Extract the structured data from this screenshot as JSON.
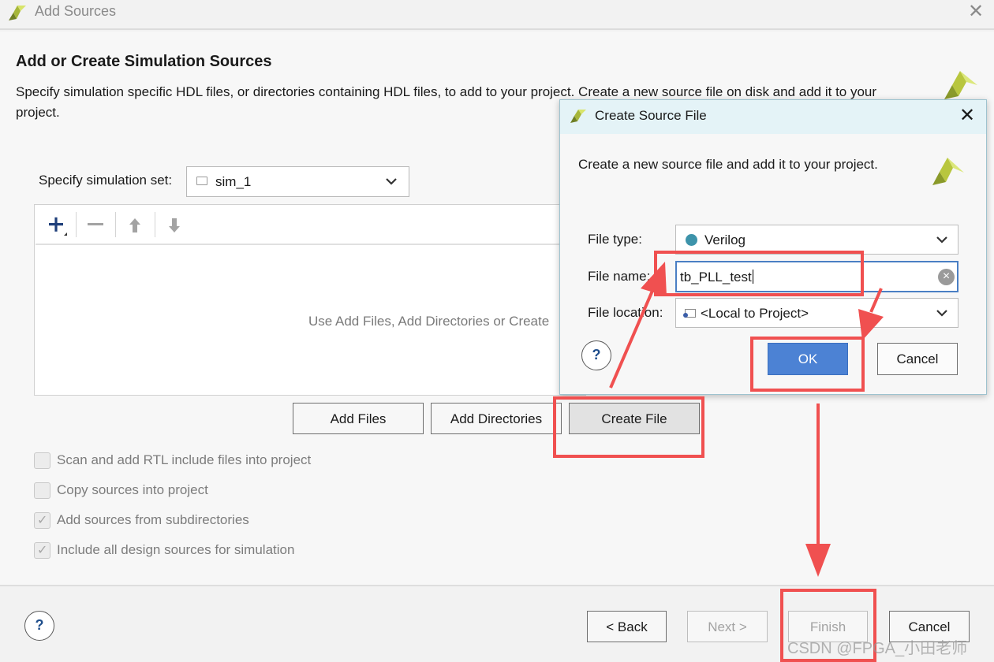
{
  "window": {
    "title": "Add Sources",
    "heading": "Add or Create Simulation Sources",
    "description": "Specify simulation specific HDL files, or directories containing HDL files, to add to your project. Create a new source file on disk and add it to your project."
  },
  "simulation_set": {
    "label": "Specify simulation set:",
    "value": "sim_1"
  },
  "panel": {
    "hint": "Use Add Files, Add Directories or Create"
  },
  "buttons": {
    "add_files": "Add Files",
    "add_directories": "Add Directories",
    "create_file": "Create File",
    "back": "< Back",
    "next": "Next >",
    "finish": "Finish",
    "cancel": "Cancel"
  },
  "options": [
    {
      "label": "Scan and add RTL include files into project",
      "checked": false
    },
    {
      "label": "Copy sources into project",
      "checked": false
    },
    {
      "label": "Add sources from subdirectories",
      "checked": true
    },
    {
      "label": "Include all design sources for simulation",
      "checked": true
    }
  ],
  "dialog": {
    "title": "Create Source File",
    "description": "Create a new source file and add it to your project.",
    "file_type_label": "File type:",
    "file_type_value": "Verilog",
    "file_name_label": "File name:",
    "file_name_value": "tb_PLL_test",
    "file_location_label": "File location:",
    "file_location_value": "<Local to Project>",
    "ok": "OK",
    "cancel": "Cancel"
  },
  "help_symbol": "?",
  "watermark": "CSDN @FPGA_小田老师",
  "colors": {
    "annotation_red": "#f05050",
    "primary_blue": "#4c82d4",
    "logo_green": "#c8d84a"
  }
}
